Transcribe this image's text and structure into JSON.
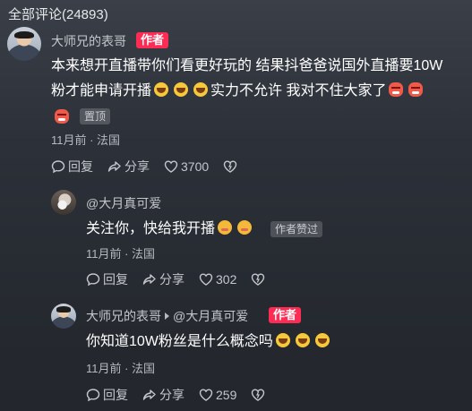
{
  "header": {
    "title": "全部评论(24893)"
  },
  "comment": {
    "name": "大师兄的表哥",
    "author_badge": "作者",
    "text_line1": "本来想开直播带你们看更好玩的 结果抖爸爸说国外直播要10W",
    "text_line2a": "粉才能申请开播",
    "text_line2b": "实力不允许 我对不住大家了",
    "pinned_badge": "置顶",
    "meta": "11月前 · 法国",
    "actions": {
      "reply": "回复",
      "share": "分享",
      "likes": "3700"
    }
  },
  "reply1": {
    "name": "@大月真可爱",
    "text": "关注你，快给我开播",
    "liked_badge": "作者赞过",
    "meta": "11月前 · 法国",
    "actions": {
      "reply": "回复",
      "share": "分享",
      "likes": "302"
    }
  },
  "reply2": {
    "name": "大师兄的表哥",
    "reply_to": "@大月真可爱",
    "author_badge": "作者",
    "text": "你知道10W粉丝是什么概念吗",
    "meta": "11月前 · 法国",
    "actions": {
      "reply": "回复",
      "share": "分享",
      "likes": "259"
    }
  },
  "colors": {
    "accent": "#fe2c55",
    "text_secondary": "#c4c7cc"
  },
  "icons": [
    "reply-icon",
    "share-icon",
    "heart-icon",
    "dislike-icon",
    "laugh-emoji-icon",
    "shy-emoji-icon",
    "angry-emoji-icon"
  ]
}
